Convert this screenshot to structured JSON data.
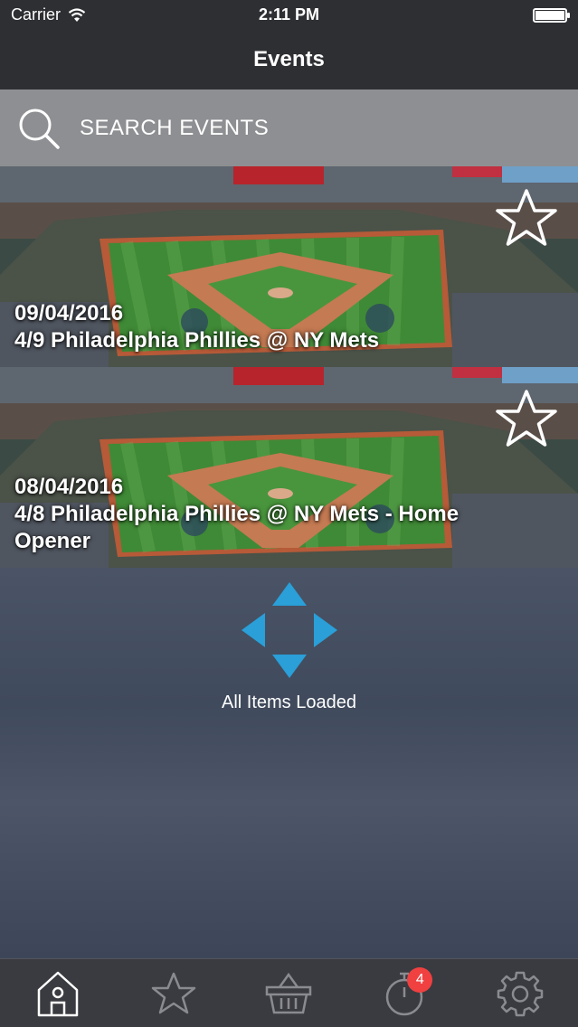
{
  "status_bar": {
    "carrier": "Carrier",
    "time": "2:11 PM"
  },
  "nav": {
    "title": "Events"
  },
  "search": {
    "placeholder": "SEARCH EVENTS",
    "icon": "search-icon"
  },
  "events": [
    {
      "date": "09/04/2016",
      "title": "4/9 Philadelphia Phillies @ NY Mets",
      "favorite": false
    },
    {
      "date": "08/04/2016",
      "title": "4/8 Philadelphia Phillies @ NY Mets - Home Opener",
      "favorite": false
    }
  ],
  "loaded": {
    "text": "All Items Loaded",
    "icon_color": "#2a9fd8"
  },
  "tab_bar": {
    "items": [
      {
        "name": "home",
        "icon": "home-icon",
        "active": true
      },
      {
        "name": "favorites",
        "icon": "star-icon",
        "active": false
      },
      {
        "name": "basket",
        "icon": "basket-icon",
        "active": false
      },
      {
        "name": "timer",
        "icon": "stopwatch-icon",
        "active": false,
        "badge": "4"
      },
      {
        "name": "settings",
        "icon": "gear-icon",
        "active": false
      }
    ]
  },
  "colors": {
    "header_bg": "#2e2f33",
    "search_bg": "#8e8f92",
    "badge": "#f04040",
    "tab_bar_bg": "#3a3b40"
  }
}
